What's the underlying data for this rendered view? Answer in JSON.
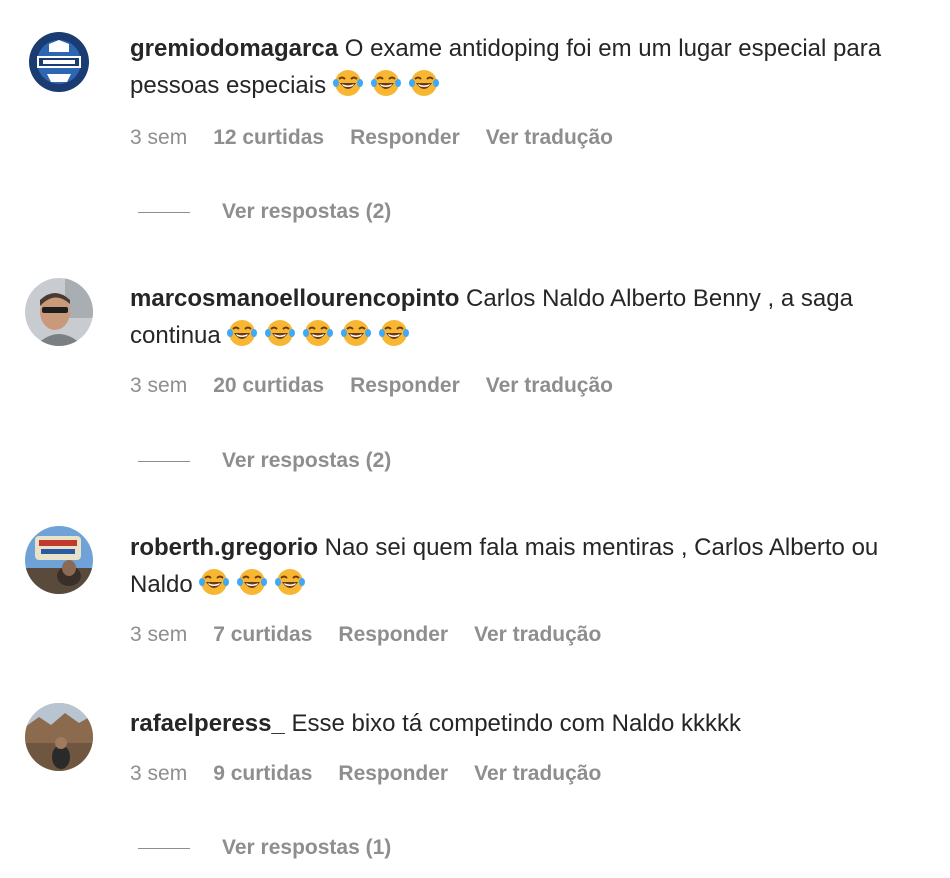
{
  "comments": [
    {
      "username": "gremiodomagarca",
      "text": " O exame antidoping foi em um lugar especial para pessoas especiais ",
      "emoji": "face-with-tears-of-joy",
      "age": "3 sem",
      "likes": "12 curtidas",
      "reply": "Responder",
      "translate": "Ver tradução",
      "view_replies": "Ver respostas (2)"
    },
    {
      "username": "marcosmanoellourencopinto",
      "text": " Carlos Naldo Alberto Benny , a saga continua ",
      "emoji": "face-with-tears-of-joy",
      "age": "3 sem",
      "likes": "20 curtidas",
      "reply": "Responder",
      "translate": "Ver tradução",
      "view_replies": "Ver respostas (2)"
    },
    {
      "username": "roberth.gregorio",
      "text": " Nao sei quem fala mais mentiras , Carlos Alberto ou Naldo ",
      "emoji": "face-with-tears-of-joy",
      "age": "3 sem",
      "likes": "7 curtidas",
      "reply": "Responder",
      "translate": "Ver tradução"
    },
    {
      "username": "rafaelperess_",
      "text": " Esse bixo tá competindo com Naldo kkkkk",
      "age": "3 sem",
      "likes": "9 curtidas",
      "reply": "Responder",
      "translate": "Ver tradução",
      "view_replies": "Ver respostas (1)"
    }
  ]
}
